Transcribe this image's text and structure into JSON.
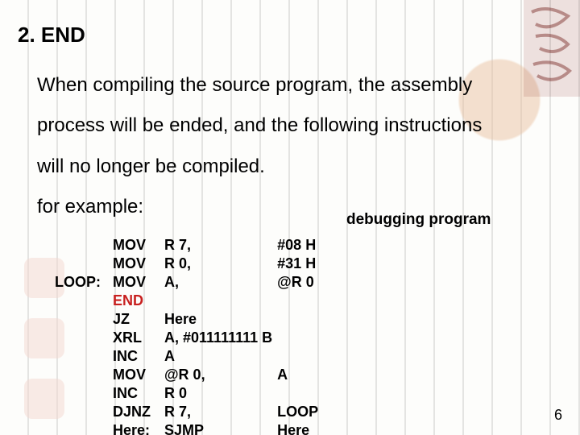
{
  "heading": "2. END",
  "para": {
    "l1": "When compiling the source program, the assembly",
    "l2": "process will be ended, and the following instructions",
    "l3": "will no longer be compiled.",
    "l4": "for example:"
  },
  "note": "debugging program",
  "page_num": "6",
  "code": {
    "rows": [
      {
        "label": "",
        "op": "MOV",
        "a1": "R 7,",
        "a2": "#08 H"
      },
      {
        "label": "",
        "op": "MOV",
        "a1": "R 0,",
        "a2": "#31 H"
      },
      {
        "label": "LOOP:",
        "op": "MOV",
        "a1": "A,",
        "a2": "@R 0"
      },
      {
        "label": "",
        "op": "END",
        "a1": "",
        "a2": "",
        "end": true
      },
      {
        "label": "",
        "op": "JZ",
        "a1": "Here",
        "a2": ""
      },
      {
        "label": "",
        "op": "XRL",
        "a1": "A, #011111111 B",
        "a2": ""
      },
      {
        "label": "",
        "op": "INC",
        "a1": "A",
        "a2": ""
      },
      {
        "label": "",
        "op": "MOV",
        "a1": "@R 0,",
        "a2": "A"
      },
      {
        "label": "",
        "op": "INC",
        "a1": "R 0",
        "a2": ""
      },
      {
        "label": "",
        "op": "DJNZ",
        "a1": "R 7,",
        "a2": "LOOP"
      },
      {
        "label": "",
        "op": "Here:",
        "a1": "SJMP",
        "a2": "Here"
      }
    ]
  }
}
